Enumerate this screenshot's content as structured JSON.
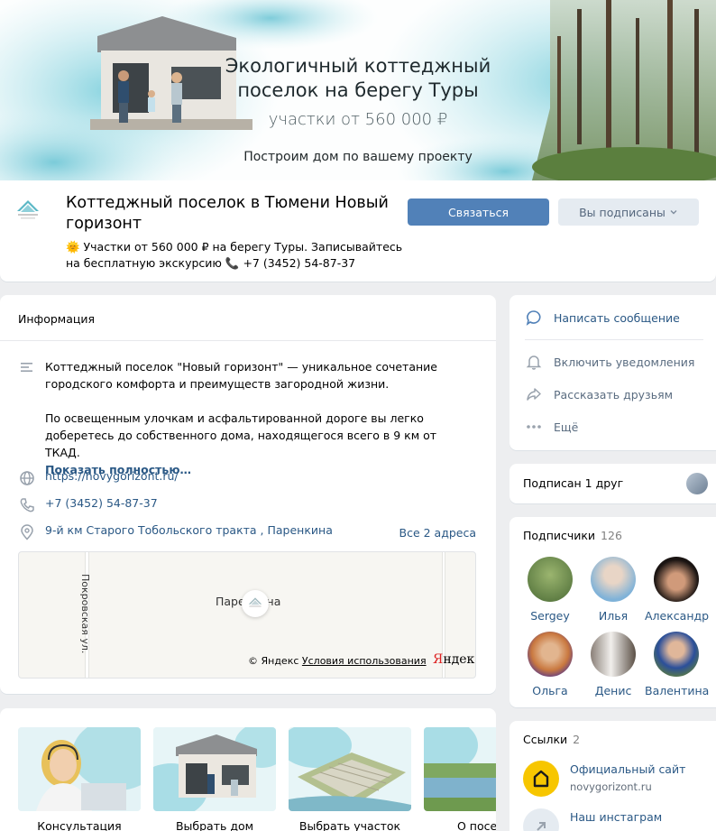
{
  "cover": {
    "title_line1": "Экологичный коттеджный",
    "title_line2": "поселок на берегу Туры",
    "subtitle": "участки от 560 000 ₽",
    "tagline": "Построим дом по вашему проекту"
  },
  "group": {
    "name": "Коттеджный поселок в Тюмени Новый горизонт",
    "status": "🌞 Участки от 560 000 ₽ на берегу Туры. Записывайтесь на бесплатную экскурсию 📞 +7 (3452) 54-87-37",
    "contact_button": "Связаться",
    "subscribed_button": "Вы подписаны"
  },
  "info": {
    "title": "Информация",
    "description_p1": "Коттеджный поселок \"Новый горизонт\" — уникальное сочетание городского комфорта и преимуществ загородной жизни.",
    "description_p2": "По освещенным улочкам и асфальтированной дороге вы легко доберетесь до собственного дома, находящегося всего в 9 км от ТКАД.",
    "show_more": "Показать полностью…",
    "website": "https://novygorizont.ru/",
    "phone": "+7 (3452) 54-87-37",
    "address": "9-й км Старого Тобольского тракта , Паренкина",
    "all_addresses": "Все 2 адреса"
  },
  "map": {
    "street_label": "Покровская ул.",
    "place_label": "Паренкина",
    "copyright": "© Яндекс",
    "terms": "Условия использования",
    "brand_first": "Я",
    "brand_rest": "ндекс"
  },
  "products": [
    {
      "label": "Консультация"
    },
    {
      "label": "Выбрать дом"
    },
    {
      "label": "Выбрать участок"
    },
    {
      "label": "О посел"
    }
  ],
  "actions": {
    "write_message": "Написать сообщение",
    "notifications": "Включить уведомления",
    "share": "Рассказать друзьям",
    "more": "Ещё"
  },
  "friends": {
    "text": "Подписан 1 друг"
  },
  "subscribers": {
    "title": "Подписчики",
    "count": "126",
    "people": [
      {
        "name": "Sergey",
        "color": "#6b8a4f"
      },
      {
        "name": "Илья",
        "color": "#7fb2d8"
      },
      {
        "name": "Александр",
        "color": "#3a2a22"
      },
      {
        "name": "Ольга",
        "color": "#c9783f"
      },
      {
        "name": "Денис",
        "color": "#9c9088"
      },
      {
        "name": "Валентина",
        "color": "#5a7a45"
      }
    ]
  },
  "links": {
    "title": "Ссылки",
    "count": "2",
    "items": [
      {
        "name": "Официальный сайт",
        "url": "novygorizont.ru"
      },
      {
        "name": "Наш инстаграм",
        "url": ""
      }
    ]
  },
  "colors": {
    "primary_button": "#5181b8",
    "link": "#2a5885",
    "background": "#edeef0"
  }
}
